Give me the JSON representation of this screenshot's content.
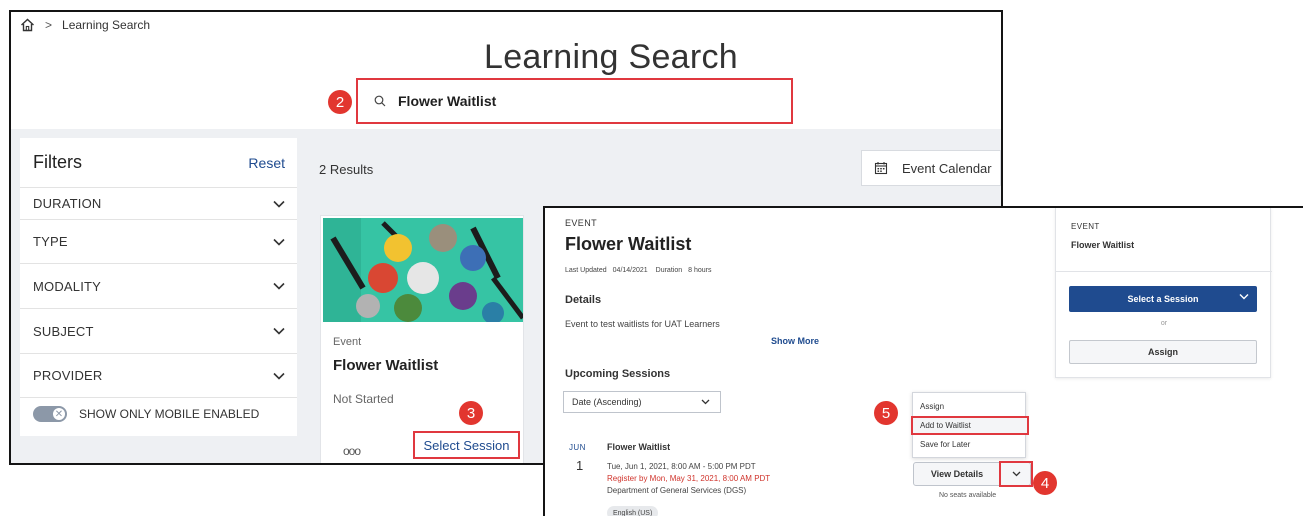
{
  "breadcrumb": {
    "home_icon": "home-icon",
    "separator": ">",
    "current": "Learning Search"
  },
  "page": {
    "title": "Learning Search"
  },
  "search": {
    "value": "Flower Waitlist",
    "icon": "search-icon"
  },
  "callouts": {
    "c2": "2",
    "c3": "3",
    "c4": "4",
    "c5": "5"
  },
  "filters": {
    "title": "Filters",
    "reset_label": "Reset",
    "items": [
      {
        "label": "DURATION"
      },
      {
        "label": "TYPE"
      },
      {
        "label": "MODALITY"
      },
      {
        "label": "SUBJECT"
      },
      {
        "label": "PROVIDER"
      }
    ],
    "mobile_toggle_label": "SHOW ONLY MOBILE ENABLED"
  },
  "results": {
    "count_text": "2 Results",
    "event_calendar_label": "Event Calendar"
  },
  "card": {
    "type": "Event",
    "title": "Flower Waitlist",
    "status": "Not Started",
    "more": "ooo",
    "select_session_label": "Select Session"
  },
  "detail": {
    "kicker": "EVENT",
    "title": "Flower Waitlist",
    "last_updated_label": "Last Updated",
    "last_updated_value": "04/14/2021",
    "duration_label": "Duration",
    "duration_value": "8 hours",
    "details_heading": "Details",
    "details_text": "Event to test waitlists for UAT Learners",
    "show_more": "Show More",
    "upcoming_heading": "Upcoming Sessions",
    "sort_value": "Date (Ascending)",
    "session": {
      "month": "JUN",
      "day": "1",
      "title": "Flower Waitlist",
      "datetime": "Tue, Jun 1, 2021, 8:00 AM - 5:00 PM PDT",
      "register_by": "Register by Mon, May 31, 2021, 8:00 AM PDT",
      "department": "Department of General Services (DGS)",
      "language": "English (US)",
      "view_details_label": "View Details",
      "no_seats": "No seats available"
    },
    "menu": [
      "Assign",
      "Add to Waitlist",
      "Save for Later"
    ]
  },
  "side_panel": {
    "kicker": "EVENT",
    "title": "Flower Waitlist",
    "select_label": "Select a Session",
    "or_label": "or",
    "assign_label": "Assign"
  },
  "colors": {
    "accent_blue": "#1f4b8f",
    "highlight_red": "#e0383f",
    "callout_red": "#e2362f"
  }
}
